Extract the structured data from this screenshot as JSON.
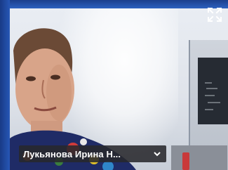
{
  "participant": {
    "name": "Лукьянова Ирина Н..."
  },
  "controls": {
    "expand_icon": "expand-icon",
    "menu_icon": "chevron-down-icon"
  },
  "colors": {
    "frame": "#2a5bb8",
    "name_bar": "#28282c",
    "name_text": "#ffffff"
  }
}
